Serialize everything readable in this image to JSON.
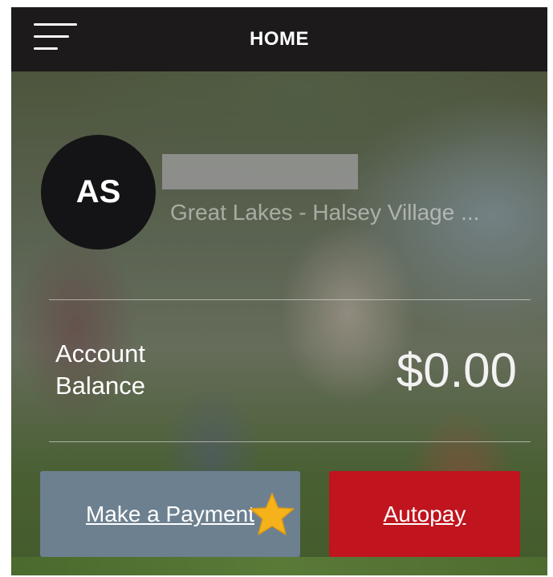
{
  "header": {
    "title": "HOME",
    "menu_icon": "hamburger-menu-icon"
  },
  "account": {
    "initials": "AS",
    "address": "Great Lakes - Halsey Village ...",
    "balance_label": "Account Balance",
    "balance_value": "$0.00"
  },
  "actions": {
    "make_payment_label": "Make a Payment",
    "autopay_label": "Autopay",
    "star_icon": "star-icon"
  },
  "colors": {
    "header_bg": "#1c1a1b",
    "avatar_bg": "#141416",
    "make_payment_bg": "#6d8090",
    "autopay_bg": "#c0141e",
    "star": "#f5b21b"
  }
}
